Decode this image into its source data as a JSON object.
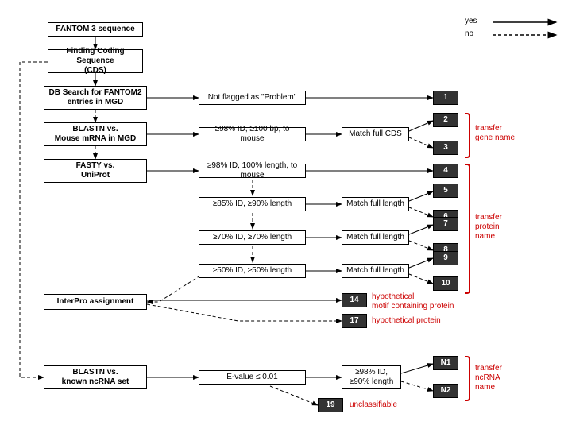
{
  "legend": {
    "yes": "yes",
    "no": "no"
  },
  "nodes": {
    "start": "FANTOM 3 sequence",
    "cds": "Finding Coding Sequence\n(CDS)",
    "dbsearch": "DB Search for FANTOM2\nentries in MGD",
    "blastn": "BLASTN vs.\nMouse  mRNA  in MGD",
    "fasty": "FASTY vs.\nUniProt",
    "interpro": "InterPro assignment",
    "blastn2": "BLASTN vs.\nknown ncRNA set",
    "c_notflag": "Not flagged as \"Problem\"",
    "c_98_100": "≥98% ID, ≥100 bp, to mouse",
    "c_98_100len": "≥98% ID, 100% length, to mouse",
    "c_85_90": "≥85% ID, ≥90% length",
    "c_70_70": "≥70% ID, ≥70% length",
    "c_50_50": "≥50% ID, ≥50% length",
    "c_evalue": "E-value ≤ 0.01",
    "c_98_90": "≥98% ID,\n≥90% length",
    "m_cds": "Match full CDS",
    "m_len1": "Match full length",
    "m_len2": "Match full length",
    "m_len3": "Match full length"
  },
  "results": {
    "r1": "1",
    "r2": "2",
    "r3": "3",
    "r4": "4",
    "r5": "5",
    "r6": "6",
    "r7": "7",
    "r8": "8",
    "r9": "9",
    "r10": "10",
    "r14": "14",
    "r17": "17",
    "r19": "19",
    "n1": "N1",
    "n2": "N2"
  },
  "labels": {
    "gene": "transfer\ngene name",
    "protein": "transfer\nprotein\nname",
    "motif": "hypothetical\nmotif containing protein",
    "hypo": "hypothetical protein",
    "unclass": "unclassifiable",
    "ncrna": "transfer\nncRNA\nname"
  }
}
